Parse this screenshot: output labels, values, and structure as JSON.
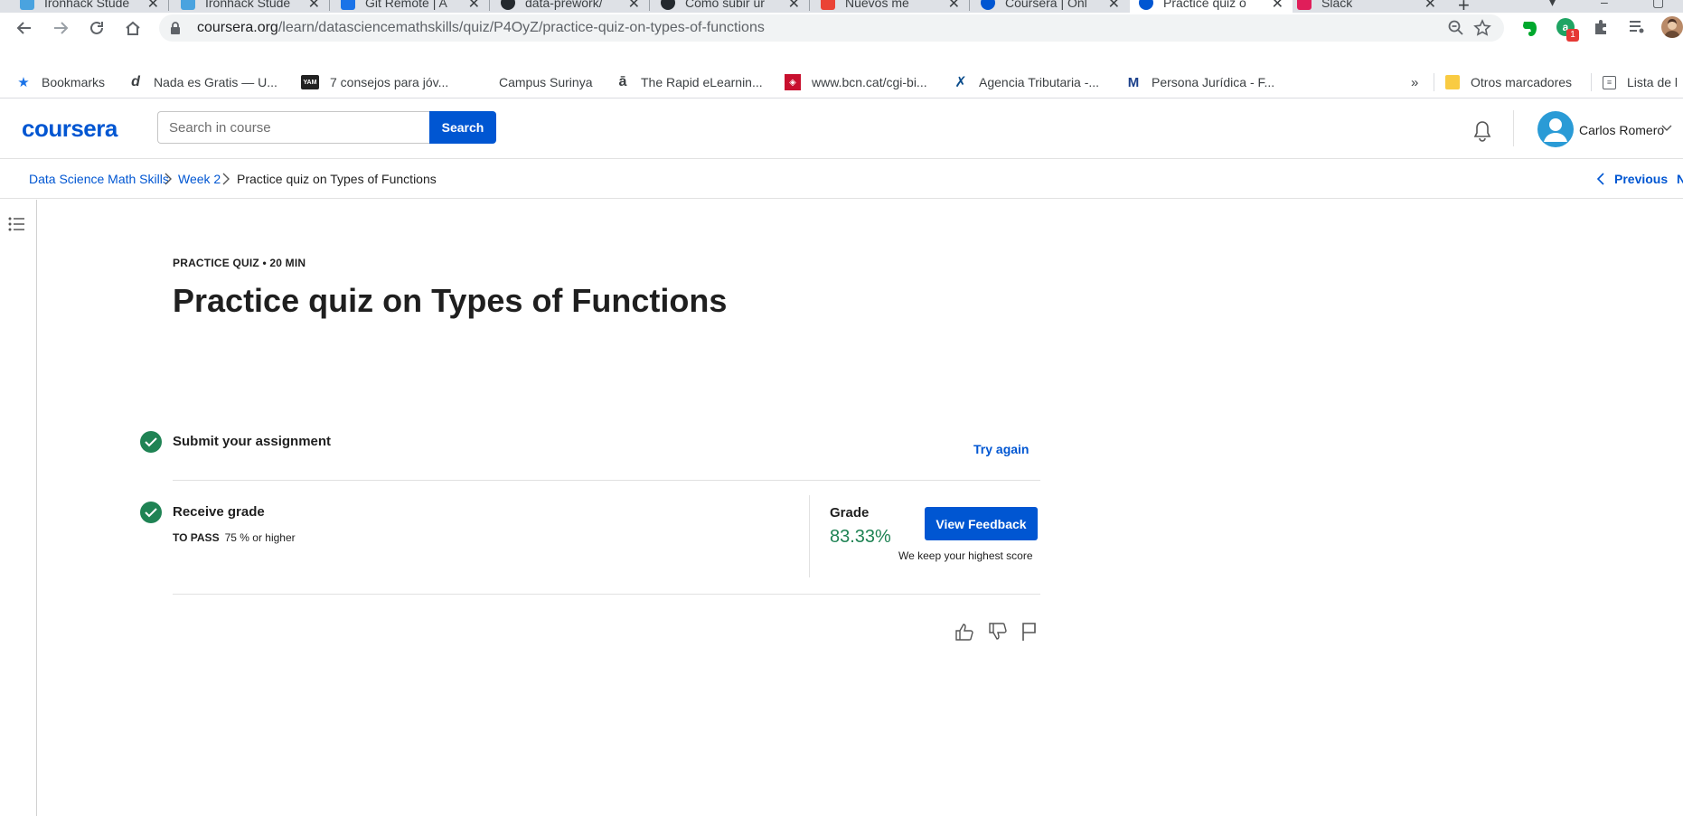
{
  "browser": {
    "tabs": [
      {
        "title": "Ironhack Stude",
        "color": "#4aa3df",
        "active": false
      },
      {
        "title": "Ironhack Stude",
        "color": "#4aa3df",
        "active": false
      },
      {
        "title": "Git Remote | A",
        "color": "#1a73e8",
        "active": false
      },
      {
        "title": "data-prework/",
        "color": "#24292e",
        "active": false
      },
      {
        "title": "Cómo subir ur",
        "color": "#24292e",
        "active": false
      },
      {
        "title": "Nuevos me",
        "color": "#ea4335",
        "active": false
      },
      {
        "title": "Coursera | Onl",
        "color": "#0056d2",
        "active": false
      },
      {
        "title": "Practice quiz o",
        "color": "#0056d2",
        "active": true
      },
      {
        "title": "Slack",
        "color": "#e01e5a",
        "active": false
      }
    ],
    "url_host": "coursera.org",
    "url_path": "/learn/datasciencemathskills/quiz/P4OyZ/practice-quiz-on-types-of-functions",
    "extension_badge": "1",
    "bookmarks": [
      {
        "label": "Bookmarks",
        "icon": "star-icon"
      },
      {
        "label": "Nada es Gratis — U...",
        "icon": "d-icon"
      },
      {
        "label": "7 consejos para jóv...",
        "icon": "yam-icon"
      },
      {
        "label": "Campus Surinya",
        "icon": ""
      },
      {
        "label": "The Rapid eLearnin...",
        "icon": "a-icon"
      },
      {
        "label": "www.bcn.cat/cgi-bi...",
        "icon": "bcn-icon"
      },
      {
        "label": "Agencia Tributaria -...",
        "icon": "agencia-icon"
      },
      {
        "label": "Persona Jurídica - F...",
        "icon": "m-icon"
      }
    ],
    "more_bookmarks": "»",
    "other_bookmarks": "Otros marcadores",
    "reading_list": "Lista de l"
  },
  "header": {
    "logo": "coursera",
    "search_placeholder": "Search in course",
    "search_button": "Search",
    "user_name": "Carlos Romero"
  },
  "breadcrumb": {
    "course": "Data Science Math Skills",
    "week": "Week 2",
    "current": "Practice quiz on Types of Functions",
    "previous": "Previous",
    "next": "N"
  },
  "quiz": {
    "kicker": "PRACTICE QUIZ • 20 MIN",
    "title": "Practice quiz on Types of Functions",
    "submit_label": "Submit your assignment",
    "try_again": "Try again",
    "receive_label": "Receive grade",
    "to_pass_label": "TO PASS",
    "to_pass_value": "75 % or higher",
    "grade_label": "Grade",
    "grade_value": "83.33%",
    "view_feedback": "View Feedback",
    "keep_note": "We keep your highest score"
  },
  "colors": {
    "brand": "#0056d2",
    "success": "#1f8354"
  }
}
